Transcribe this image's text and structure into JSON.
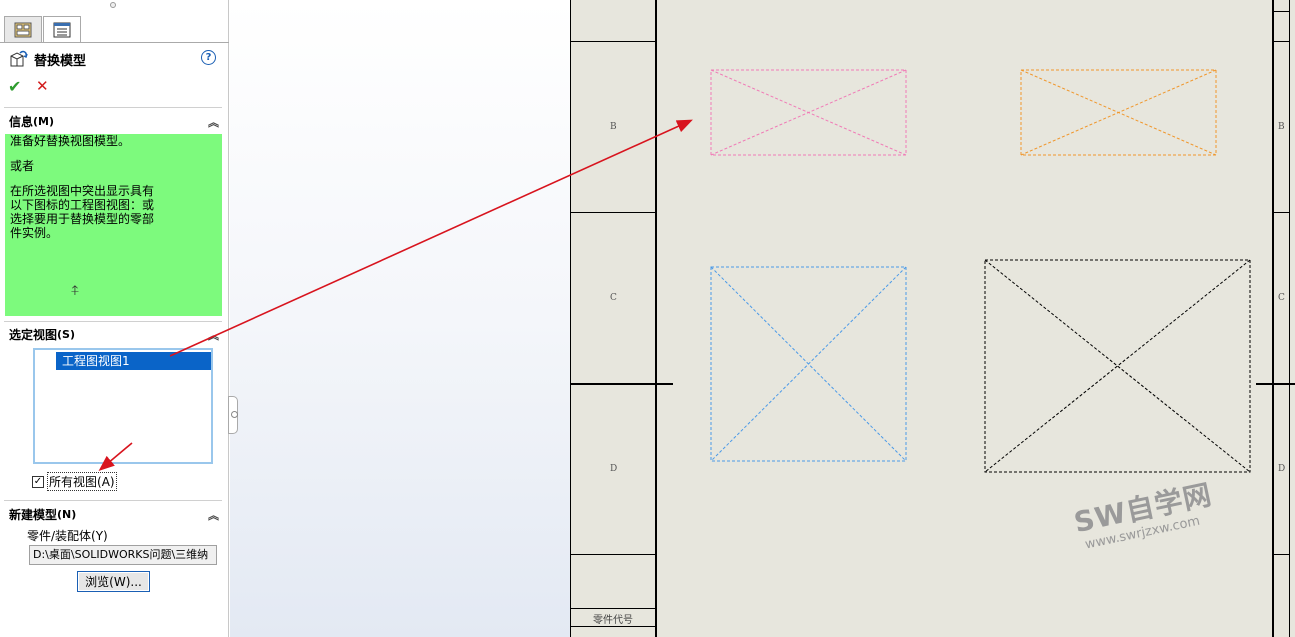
{
  "property_manager": {
    "title": "替换模型",
    "help_symbol": "?",
    "ok_symbol": "✔",
    "cancel_symbol": "✕",
    "sections": {
      "info": {
        "title": "信息",
        "key": "(M)",
        "lines": [
          "准备好替换视图模型。",
          "",
          "或者",
          "",
          "在所选视图中突出显示具有",
          "以下图标的工程图视图：或",
          "选择要用于替换模型的零部",
          "件实例。"
        ]
      },
      "selected_views": {
        "title": "选定视图",
        "key": "(S)",
        "items": [
          "工程图视图1"
        ],
        "all_views_label": "所有视图",
        "all_views_key": "(A)",
        "all_views_checked": true,
        "check_symbol": "✓"
      },
      "new_model": {
        "title": "新建模型",
        "key": "(N)",
        "part_label": "零件/装配体",
        "part_key": "(Y)",
        "path_value": "D:\\桌面\\SOLIDWORKS问题\\三维纳",
        "browse_label": "浏览(W)..."
      }
    },
    "collapse_symbol": "︽"
  },
  "sheet": {
    "zone_letters_left": [
      "B",
      "C",
      "D"
    ],
    "zone_letters_right": [
      "B",
      "C",
      "D"
    ],
    "title_block_text": "零件代号",
    "view_colors": [
      "#f07ab6",
      "#f0962a",
      "#4b9ae8",
      "#000000"
    ]
  },
  "annotation": {
    "arrow_color": "#d8141e"
  },
  "watermark": {
    "main": "SW自学网",
    "sub": "www.swrjzxw.com"
  }
}
